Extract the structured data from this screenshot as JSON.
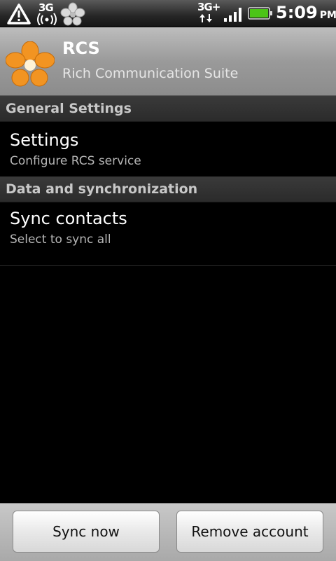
{
  "status_bar": {
    "left_network_label": "3G",
    "right_network_label": "3G+",
    "time": "5:09",
    "ampm": "PM",
    "icons": [
      "warning-icon",
      "wifi-hotspot-icon",
      "flower-notification-icon",
      "data-arrows-icon",
      "signal-icon",
      "battery-icon"
    ],
    "battery_color": "#4cc417"
  },
  "header": {
    "title": "RCS",
    "subtitle": "Rich Communication Suite",
    "logo_color": "#f29422"
  },
  "sections": [
    {
      "label": "General Settings",
      "items": [
        {
          "title": "Settings",
          "summary": "Configure RCS service"
        }
      ]
    },
    {
      "label": "Data and synchronization",
      "items": [
        {
          "title": "Sync contacts",
          "summary": "Select to sync all"
        }
      ]
    }
  ],
  "buttons": {
    "sync_now": "Sync now",
    "remove_account": "Remove account"
  }
}
